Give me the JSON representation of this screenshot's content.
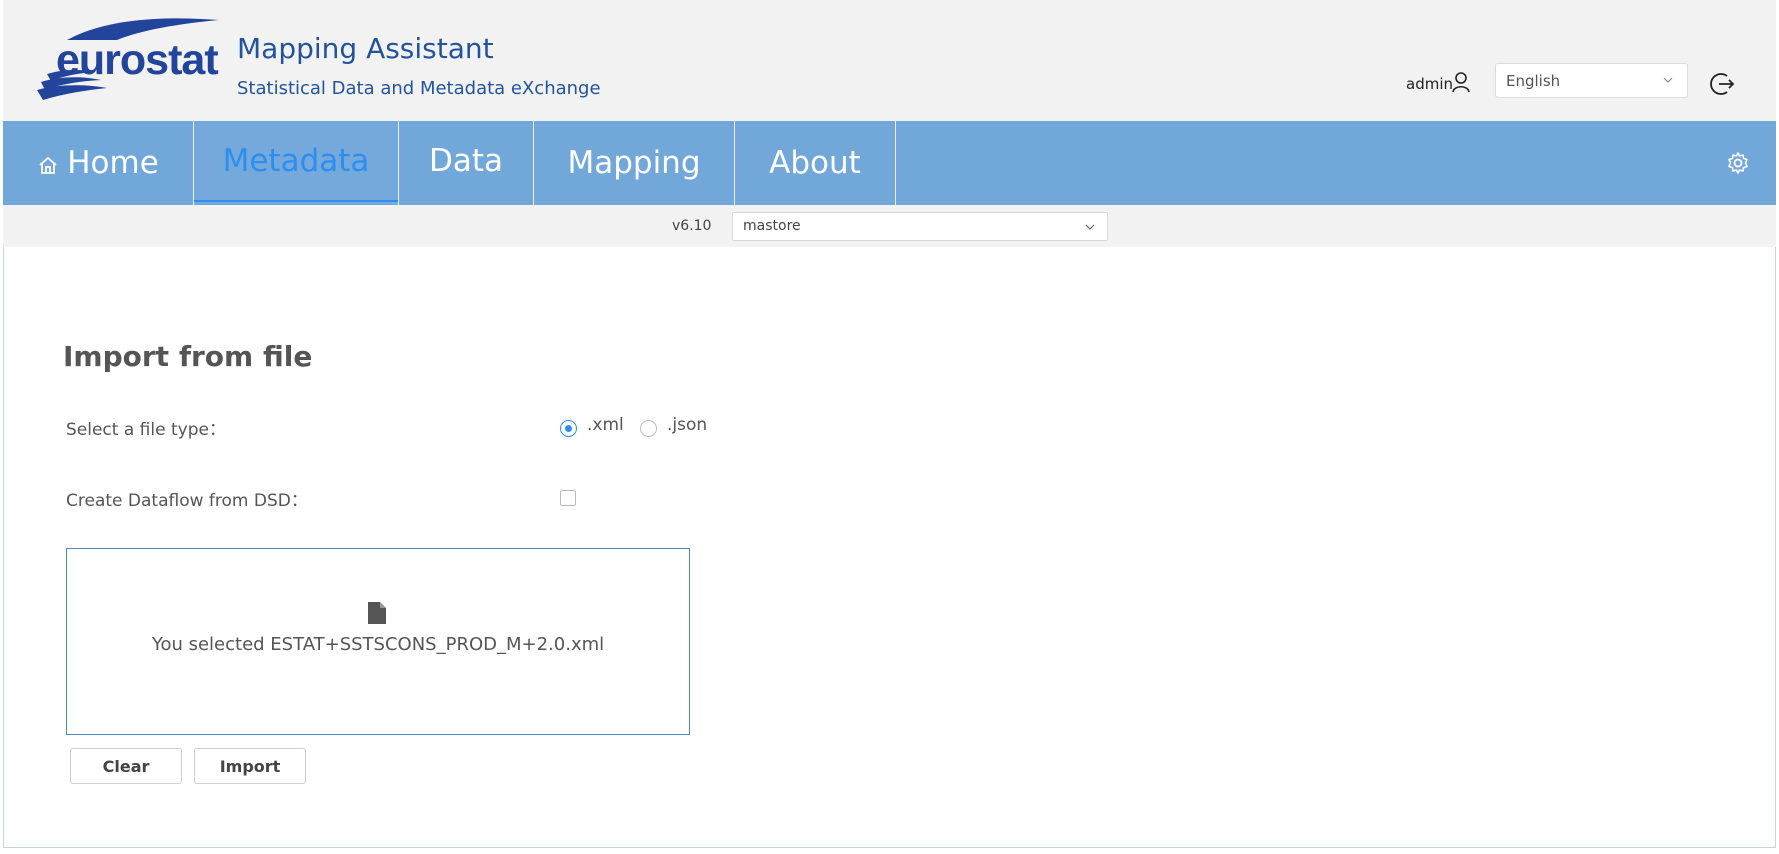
{
  "header": {
    "logo_text": "eurostat",
    "app_title": "Mapping Assistant",
    "app_subtitle": "Statistical Data and Metadata eXchange",
    "user": "admin",
    "language": {
      "selected": "English"
    }
  },
  "nav": {
    "items": [
      {
        "label": "Home",
        "icon": "home-icon",
        "active": false
      },
      {
        "label": "Metadata",
        "active": true
      },
      {
        "label": "Data",
        "active": false
      },
      {
        "label": "Mapping",
        "active": false
      },
      {
        "label": "About",
        "active": false
      }
    ],
    "settings_icon": "gear-icon"
  },
  "subbar": {
    "version": "v6.10",
    "store": {
      "selected": "mastore"
    }
  },
  "import": {
    "title": "Import from file",
    "file_type_label": "Select a file type：",
    "file_types": [
      {
        "label": ".xml",
        "checked": true
      },
      {
        "label": ".json",
        "checked": false
      }
    ],
    "dataflow_label": "Create Dataflow from DSD：",
    "dataflow_checked": false,
    "dropzone_text": "You selected ESTAT+SSTSCONS_PROD_M+2.0.xml",
    "clear_label": "Clear",
    "import_label": "Import"
  },
  "colors": {
    "nav_bg": "#72a7da",
    "active": "#2d8ef0",
    "brand": "#23449b"
  }
}
